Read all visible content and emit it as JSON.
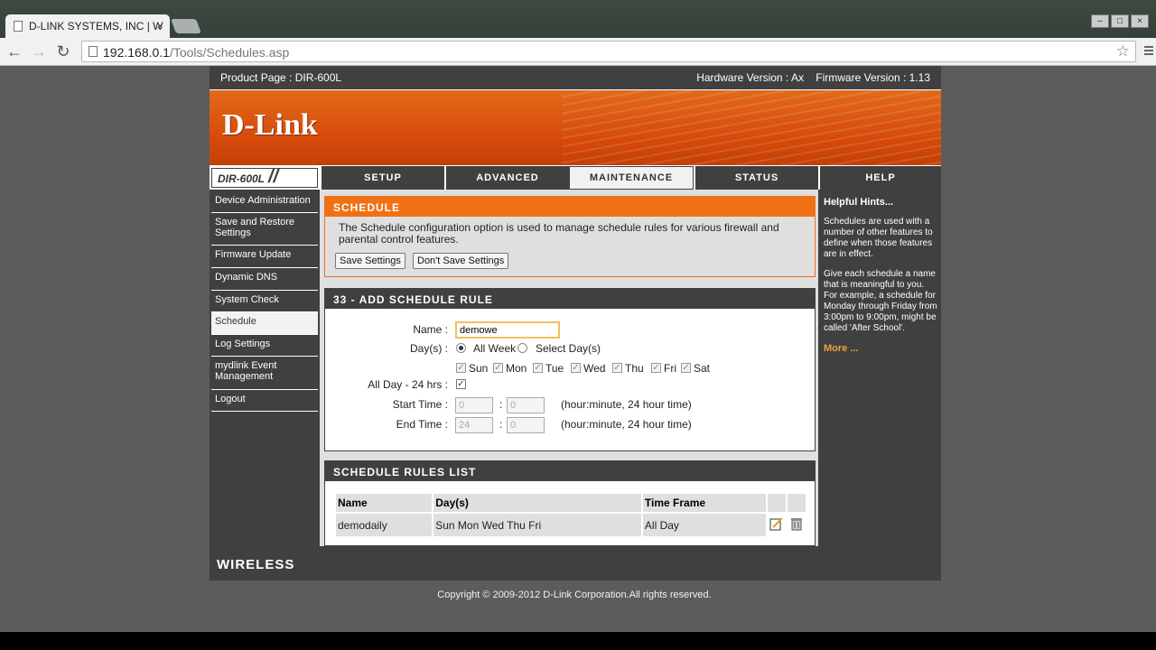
{
  "browser": {
    "tab_title": "D-LINK SYSTEMS, INC | W",
    "url_host": "192.168.0.1",
    "url_path": "/Tools/Schedules.asp"
  },
  "infobar": {
    "product": "Product Page : DIR-600L",
    "versions": "Hardware Version : Ax    Firmware Version : 1.13"
  },
  "banner": {
    "logo": "D-Link",
    "model": "DIR-600L"
  },
  "nav_tabs": [
    "SETUP",
    "ADVANCED",
    "MAINTENANCE",
    "STATUS",
    "HELP"
  ],
  "active_tab": "MAINTENANCE",
  "sidebar": {
    "items": [
      "Device Administration",
      "Save and Restore Settings",
      "Firmware Update",
      "Dynamic DNS",
      "System Check",
      "Schedule",
      "Log Settings",
      "mydlink Event Management",
      "Logout"
    ],
    "active": "Schedule"
  },
  "schedule_panel": {
    "title": "SCHEDULE",
    "description": "The Schedule configuration option is used to manage schedule rules for various firewall and parental control features.",
    "save_label": "Save Settings",
    "dont_save_label": "Don't Save Settings"
  },
  "add_rule": {
    "title": "33 - ADD SCHEDULE RULE",
    "name_label": "Name :",
    "name_value": "demowe",
    "days_label": "Day(s) :",
    "all_week_label": "All Week",
    "select_days_label": "Select Day(s)",
    "days_mode": "All Week",
    "days": [
      "Sun",
      "Mon",
      "Tue",
      "Wed",
      "Thu",
      "Fri",
      "Sat"
    ],
    "all_day_label": "All Day - 24 hrs :",
    "all_day_checked": true,
    "start_label": "Start Time :",
    "start_hour": "0",
    "start_minute": "0",
    "end_label": "End Time :",
    "end_hour": "24",
    "end_minute": "0",
    "time_hint": "(hour:minute, 24 hour time)",
    "colon": ":"
  },
  "rules_list": {
    "title": "SCHEDULE RULES LIST",
    "headers": [
      "Name",
      "Day(s)",
      "Time Frame"
    ],
    "rows": [
      {
        "name": "demodaily",
        "days": "Sun Mon Wed Thu Fri",
        "time_frame": "All Day"
      }
    ]
  },
  "hints": {
    "title": "Helpful Hints...",
    "p1": "Schedules are used with a number of other features to define when those features are in effect.",
    "p2": "Give each schedule a name that is meaningful to you. For example, a schedule for Monday through Friday from 3:00pm to 9:00pm, might be called 'After School'.",
    "more": "More ..."
  },
  "footer": {
    "wireless": "WIRELESS",
    "copyright": "Copyright © 2009-2012 D-Link Corporation.All rights reserved."
  }
}
